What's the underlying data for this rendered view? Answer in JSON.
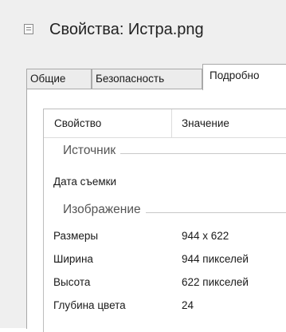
{
  "window": {
    "title": "Свойства: Истра.png",
    "icon": "file-icon"
  },
  "tabs": [
    {
      "label": "Общие",
      "active": false
    },
    {
      "label": "Безопасность",
      "active": false
    },
    {
      "label": "Подробно",
      "active": true
    }
  ],
  "details": {
    "columns": {
      "property": "Свойство",
      "value": "Значение"
    },
    "groups": [
      {
        "label": "Источник",
        "rows": [
          {
            "property": "Дата съемки",
            "value": ""
          }
        ]
      },
      {
        "label": "Изображение",
        "rows": [
          {
            "property": "Размеры",
            "value": "944 x 622"
          },
          {
            "property": "Ширина",
            "value": "944 пикселей"
          },
          {
            "property": "Высота",
            "value": "622 пикселей"
          },
          {
            "property": "Глубина цвета",
            "value": "24"
          }
        ]
      }
    ]
  }
}
